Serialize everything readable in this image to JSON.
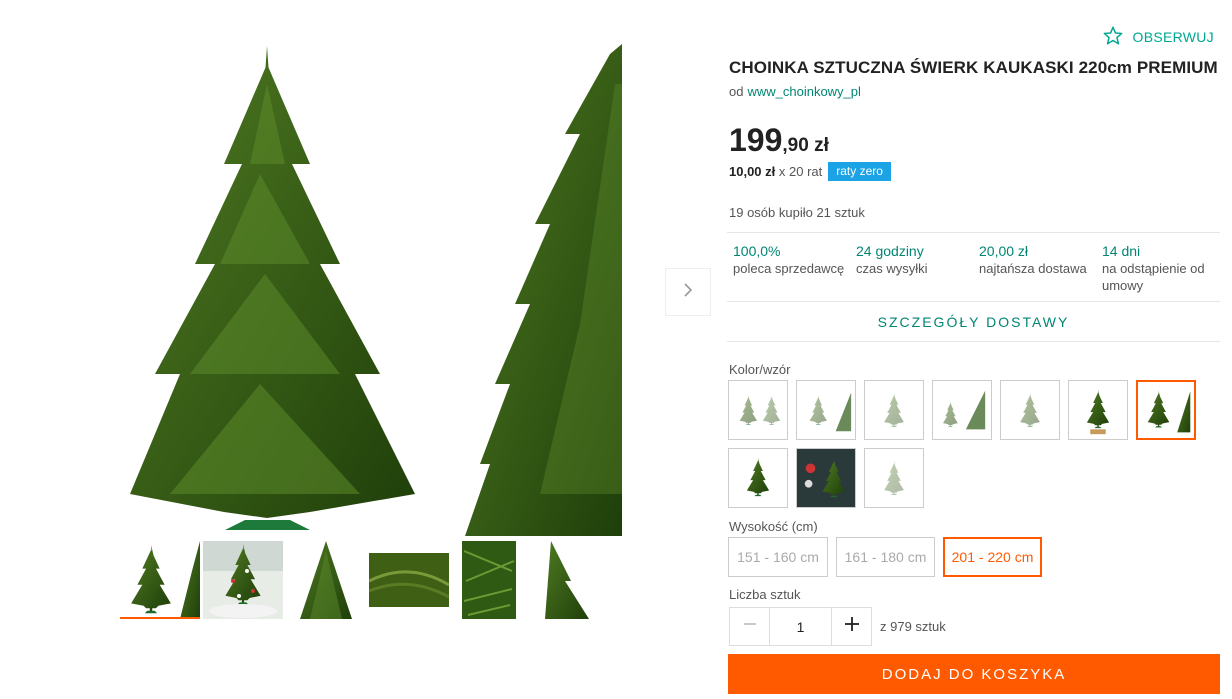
{
  "gallery": {
    "next_icon": "chevron-right-icon",
    "thumbnails": [
      {
        "name": "thumb-tree-full"
      },
      {
        "name": "thumb-tree-decorated"
      },
      {
        "name": "thumb-tree-closeup"
      },
      {
        "name": "thumb-needles"
      },
      {
        "name": "thumb-branches"
      },
      {
        "name": "thumb-tree-side"
      }
    ]
  },
  "watch": {
    "label": "OBSERWUJ",
    "icon": "star-outline-icon"
  },
  "product": {
    "title": "CHOINKA SZTUCZNA ŚWIERK KAUKASKI 220cm PREMIUM",
    "seller_prefix": "od",
    "seller_name": "www_choinkowy_pl"
  },
  "price": {
    "main": "199",
    "fraction": ",90 zł",
    "installment_amount": "10,00 zł",
    "installment_count": "x 20 rat",
    "badge": "raty zero"
  },
  "sold_info": "19 osób kupiło 21 sztuk",
  "stats": [
    {
      "value": "100,0%",
      "label": "poleca sprzedawcę"
    },
    {
      "value": "24 godziny",
      "label": "czas wysyłki"
    },
    {
      "value": "20,00 zł",
      "label": "najtańsza dostawa"
    },
    {
      "value": "14 dni",
      "label": "na odstąpienie od umowy"
    }
  ],
  "delivery_details": "SZCZEGÓŁY DOSTAWY",
  "variants": {
    "label": "Kolor/wzór",
    "selected_index": 6,
    "count": 10
  },
  "height": {
    "label": "Wysokość (cm)",
    "options": [
      "151 - 160 cm",
      "161 - 180 cm",
      "201 - 220 cm"
    ],
    "selected_index": 2
  },
  "quantity": {
    "label": "Liczba sztuk",
    "value": "1",
    "stock": "z 979 sztuk"
  },
  "add_to_cart": "DODAJ DO KOSZYKA",
  "colors": {
    "accent": "#ff5a00",
    "link": "#008673",
    "badge": "#1ba3e6",
    "tree": "#2f5a14"
  }
}
